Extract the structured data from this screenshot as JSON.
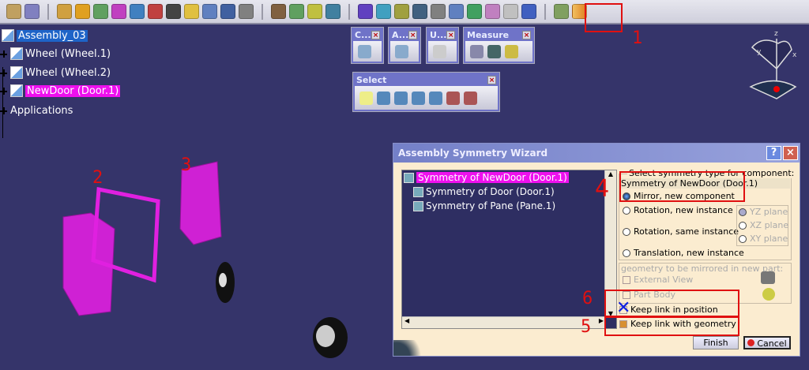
{
  "toolbar": {
    "icon_colors": [
      "#c0a060",
      "#8080c0",
      "#d0a040",
      "#e0a020",
      "#60a060",
      "#c040c0",
      "#4080c0",
      "#c04040",
      "#444",
      "#e0c040",
      "#6080c0",
      "#4060a0",
      "#808080",
      "#806040",
      "#60a060",
      "#c0c040",
      "#4080a0",
      "#6040c0",
      "#40a0c0",
      "#a0a040",
      "#406080",
      "#808080",
      "#6080c0",
      "#40a060",
      "#c080c0",
      "#c0c0c0",
      "#4060c0",
      "#80a060"
    ],
    "product_sym_icon": "product-symmetry-icon"
  },
  "tree": {
    "root": "Assembly_03",
    "items": [
      "Wheel (Wheel.1)",
      "Wheel (Wheel.2)",
      "NewDoor (Door.1)"
    ],
    "applications": "Applications"
  },
  "palettes": [
    {
      "title": "C...",
      "close": "×"
    },
    {
      "title": "A...",
      "close": "×"
    },
    {
      "title": "U...",
      "close": "×"
    },
    {
      "title": "Measure",
      "close": "×"
    },
    {
      "title": "Select",
      "close": "×"
    }
  ],
  "compass": {
    "z": "z",
    "x": "x",
    "y": "y"
  },
  "dialog": {
    "title": "Assembly Symmetry Wizard",
    "help": "?",
    "close": "×",
    "tree": [
      "Symmetry of NewDoor (Door.1)",
      "Symmetry of Door (Door.1)",
      "Symmetry of Pane (Pane.1)"
    ],
    "group_label": "Select symmetry type for component:",
    "selected_component": "Symmetry of NewDoor (Door.1)",
    "options": [
      "Mirror, new component",
      "Rotation, new instance",
      "Rotation, same instance",
      "Translation, new instance"
    ],
    "selected_option": 0,
    "planes": [
      "YZ plane",
      "XZ plane",
      "XY plane"
    ],
    "geometry_label": "geometry to be mirrored in new part:",
    "geometry_options": [
      "External View",
      "Part Body"
    ],
    "keep_position": "Keep link in position",
    "keep_geometry": "Keep link with geometry",
    "finish": "Finish",
    "cancel": "Cancel"
  },
  "annotations": [
    "1",
    "2",
    "3",
    "4",
    "5",
    "6"
  ],
  "colors": {
    "background": "#35346a",
    "highlight": "#ee10ee",
    "selection": "#1e64c8",
    "door": "#e020e0"
  }
}
